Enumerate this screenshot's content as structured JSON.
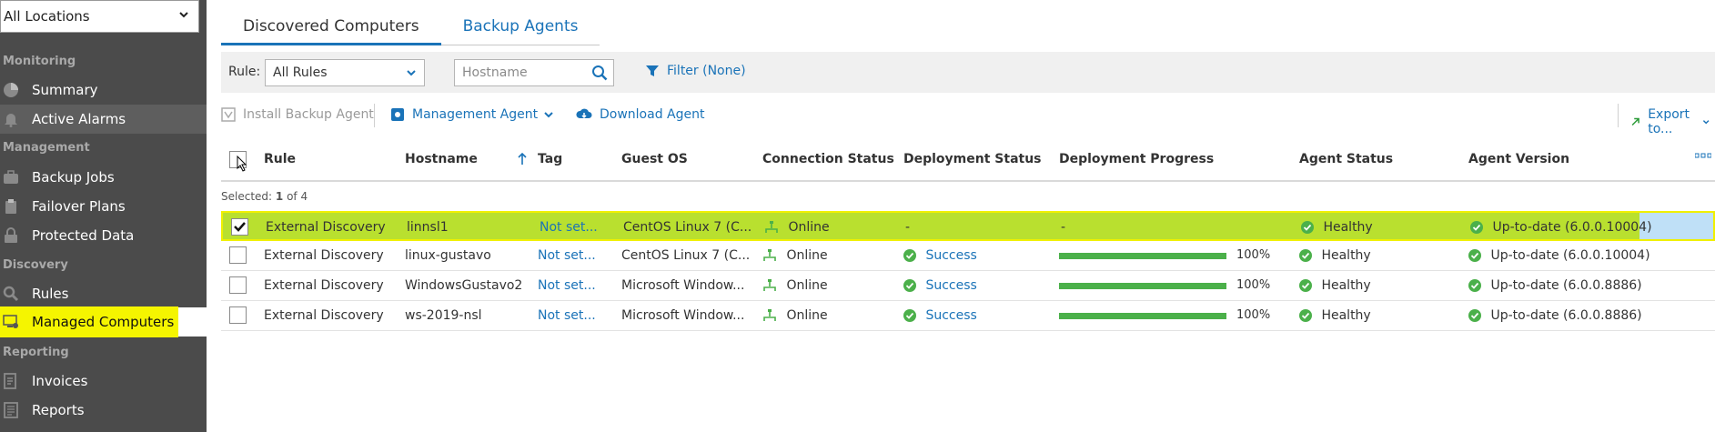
{
  "sidebar": {
    "location_select": "All Locations",
    "sections": {
      "monitoring": "Monitoring",
      "management": "Management",
      "discovery": "Discovery",
      "reporting": "Reporting"
    },
    "items": {
      "summary": "Summary",
      "active_alarms": "Active Alarms",
      "backup_jobs": "Backup Jobs",
      "failover_plans": "Failover Plans",
      "protected_data": "Protected Data",
      "rules": "Rules",
      "managed_computers": "Managed Computers",
      "invoices": "Invoices",
      "reports": "Reports"
    }
  },
  "tabs": {
    "discovered": "Discovered Computers",
    "backup_agents": "Backup Agents"
  },
  "filters": {
    "rule_label": "Rule:",
    "rule_value": "All Rules",
    "hostname_placeholder": "Hostname",
    "filter_label": "Filter (None)"
  },
  "toolbar": {
    "install": "Install Backup Agent",
    "management_agent": "Management Agent",
    "download_agent": "Download Agent",
    "export": "Export to..."
  },
  "grid": {
    "headers": {
      "rule": "Rule",
      "hostname": "Hostname",
      "tag": "Tag",
      "guest_os": "Guest OS",
      "connection_status": "Connection Status",
      "deployment_status": "Deployment Status",
      "deployment_progress": "Deployment Progress",
      "agent_status": "Agent Status",
      "agent_version": "Agent Version"
    },
    "selected_prefix": "Selected: ",
    "selected_count": "1",
    "selected_suffix": " of 4",
    "rows": [
      {
        "rule": "External Discovery",
        "hostname": "linnsl1",
        "tag": "Not set...",
        "guest_os": "CentOS Linux 7 (C...",
        "connection": "Online",
        "deployment_status": "-",
        "deployment_progress": "-",
        "progress_value": 0,
        "progress_label": "",
        "agent_status": "Healthy",
        "agent_version": "Up-to-date (6.0.0.10004)"
      },
      {
        "rule": "External Discovery",
        "hostname": "linux-gustavo",
        "tag": "Not set...",
        "guest_os": "CentOS Linux 7 (C...",
        "connection": "Online",
        "deployment_status": "Success",
        "deployment_progress": "",
        "progress_value": 100,
        "progress_label": "100%",
        "agent_status": "Healthy",
        "agent_version": "Up-to-date (6.0.0.10004)"
      },
      {
        "rule": "External Discovery",
        "hostname": "WindowsGustavo2",
        "tag": "Not set...",
        "guest_os": "Microsoft Window...",
        "connection": "Online",
        "deployment_status": "Success",
        "deployment_progress": "",
        "progress_value": 100,
        "progress_label": "100%",
        "agent_status": "Healthy",
        "agent_version": "Up-to-date (6.0.0.8886)"
      },
      {
        "rule": "External Discovery",
        "hostname": "ws-2019-nsl",
        "tag": "Not set...",
        "guest_os": "Microsoft Window...",
        "connection": "Online",
        "deployment_status": "Success",
        "deployment_progress": "",
        "progress_value": 100,
        "progress_label": "100%",
        "agent_status": "Healthy",
        "agent_version": "Up-to-date (6.0.0.8886)"
      }
    ]
  },
  "colors": {
    "sidebar_bg": "#4b4b4b",
    "accent": "#1a73b8",
    "highlight": "#f5f500",
    "selected_row": "#b9e02f",
    "success": "#4bb04a"
  }
}
